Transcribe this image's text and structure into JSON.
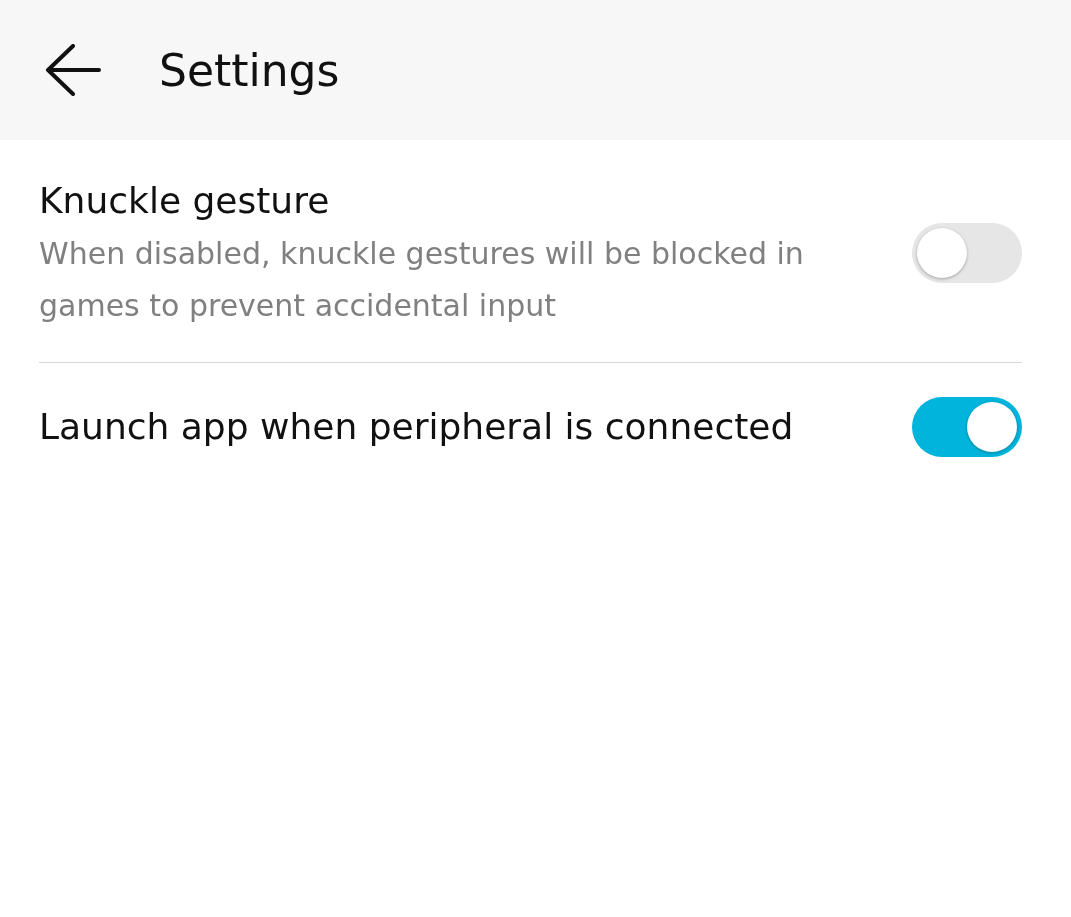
{
  "header": {
    "title": "Settings"
  },
  "settings": [
    {
      "title": "Knuckle gesture",
      "description": "When disabled, knuckle gestures will be blocked in games to prevent accidental input",
      "on": false
    },
    {
      "title": "Launch app when peripheral is connected",
      "on": true
    }
  ]
}
